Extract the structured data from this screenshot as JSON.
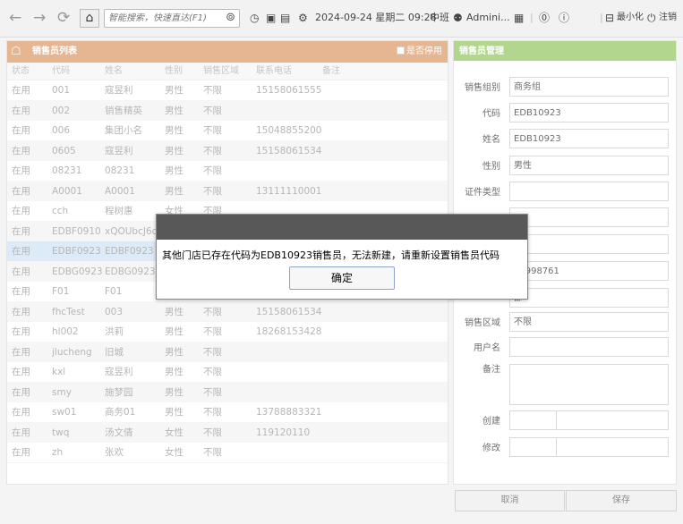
{
  "toolbar": {
    "back_icon": "arrow-left-icon",
    "forward_icon": "arrow-right-icon",
    "refresh_icon": "refresh-icon",
    "home_icon": "home-icon",
    "search": {
      "placeholder": "智能搜索，快速直达(F1)"
    },
    "datetime": "2024-09-24 星期二 09:28",
    "shift": "中班",
    "user": "Admini...",
    "minimize": "最小化",
    "logout": "注销"
  },
  "list_panel": {
    "title": "销售员列表",
    "show_disabled_label": "是否停用",
    "header_color": "#e2aa80",
    "columns": [
      "状态",
      "代码",
      "姓名",
      "性别",
      "销售区域",
      "联系电话",
      "备注"
    ],
    "rows": [
      [
        "在用",
        "001",
        "寇昱利",
        "男性",
        "不限",
        "15158061555",
        ""
      ],
      [
        "在用",
        "002",
        "销售精英",
        "男性",
        "不限",
        "",
        ""
      ],
      [
        "在用",
        "006",
        "集团小名",
        "男性",
        "不限",
        "15048855200",
        ""
      ],
      [
        "在用",
        "0605",
        "寇昱利",
        "男性",
        "不限",
        "15158061534",
        ""
      ],
      [
        "在用",
        "08231",
        "08231",
        "男性",
        "不限",
        "",
        ""
      ],
      [
        "在用",
        "A0001",
        "A0001",
        "男性",
        "不限",
        "13111110001",
        ""
      ],
      [
        "在用",
        "cch",
        "程树惠",
        "女性",
        "不限",
        "",
        ""
      ],
      [
        "在用",
        "EDBF0910",
        "xQOUbcJ6c",
        "",
        "",
        "",
        ""
      ],
      [
        "在用",
        "EDBF0923",
        "EDBF0923",
        "",
        "",
        "",
        ""
      ],
      [
        "在用",
        "EDBG0923",
        "EDBG0923",
        "",
        "",
        "",
        ""
      ],
      [
        "在用",
        "F01",
        "F01",
        "",
        "",
        "",
        ""
      ],
      [
        "在用",
        "fhcTest",
        "003",
        "男性",
        "不限",
        "15158061534",
        ""
      ],
      [
        "在用",
        "hl002",
        "洪莉",
        "男性",
        "不限",
        "18268153428",
        ""
      ],
      [
        "在用",
        "jlucheng",
        "旧城",
        "男性",
        "不限",
        "",
        ""
      ],
      [
        "在用",
        "kxl",
        "寇昱利",
        "男性",
        "不限",
        "",
        ""
      ],
      [
        "在用",
        "smy",
        "施梦园",
        "男性",
        "不限",
        "",
        ""
      ],
      [
        "在用",
        "sw01",
        "商务01",
        "男性",
        "不限",
        "13788883321",
        ""
      ],
      [
        "在用",
        "twq",
        "汤文倩",
        "女性",
        "不限",
        "119120110",
        ""
      ],
      [
        "在用",
        "zh",
        "张欢",
        "女性",
        "不限",
        "",
        ""
      ]
    ]
  },
  "form_panel": {
    "title": "销售员管理",
    "header_color": "#a6cf7c",
    "fields": [
      {
        "label": "销售组别",
        "value": "商务组"
      },
      {
        "label": "代码",
        "value": "EDB10923"
      },
      {
        "label": "姓名",
        "value": "EDB10923"
      },
      {
        "label": "性别",
        "value": "男性"
      },
      {
        "label": "证件类型",
        "value": ""
      },
      {
        "label": "",
        "value": ""
      },
      {
        "label": "",
        "value": ""
      },
      {
        "label": "",
        "value": "99998761"
      },
      {
        "label": "",
        "value": "部"
      },
      {
        "label": "销售区域",
        "value": "不限"
      },
      {
        "label": "用户名",
        "value": ""
      },
      {
        "label": "备注",
        "value": ""
      },
      {
        "label": "创建",
        "value": ""
      },
      {
        "label": "修改",
        "value": ""
      }
    ],
    "cancel_label": "取消",
    "save_label": "保存"
  },
  "dialog": {
    "message": "其他门店已存在代码为EDB10923销售员，无法新建，请重新设置销售员代码",
    "ok_label": "确定"
  }
}
